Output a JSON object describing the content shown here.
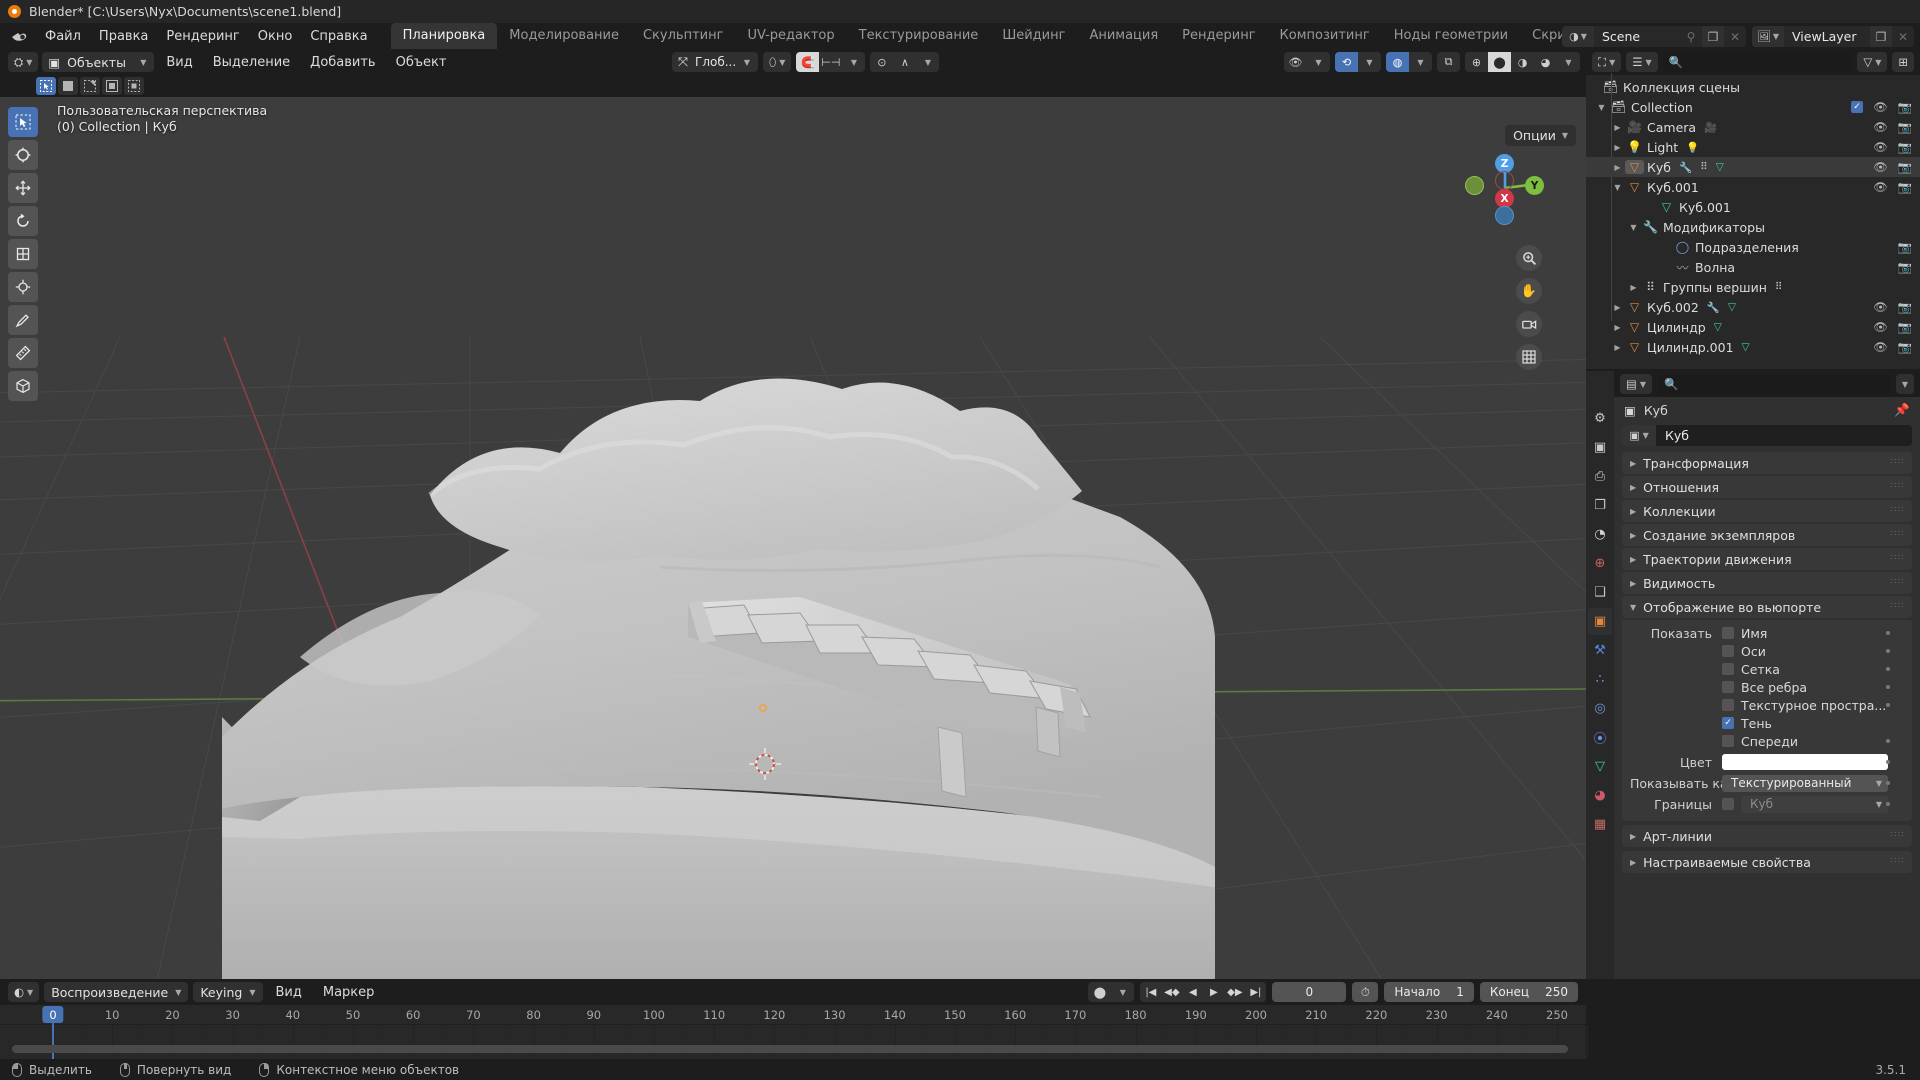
{
  "window": {
    "title": "Blender* [C:\\Users\\Nyx\\Documents\\scene1.blend]",
    "app_icon": "blender-logo-icon"
  },
  "menus": [
    "Файл",
    "Правка",
    "Рендеринг",
    "Окно",
    "Справка"
  ],
  "workspace_tabs": [
    {
      "label": "Планировка",
      "active": true
    },
    {
      "label": "Моделирование",
      "active": false
    },
    {
      "label": "Скульптинг",
      "active": false
    },
    {
      "label": "UV-редактор",
      "active": false
    },
    {
      "label": "Текстурирование",
      "active": false
    },
    {
      "label": "Шейдинг",
      "active": false
    },
    {
      "label": "Анимация",
      "active": false
    },
    {
      "label": "Рендеринг",
      "active": false
    },
    {
      "label": "Композитинг",
      "active": false
    },
    {
      "label": "Ноды геометрии",
      "active": false
    },
    {
      "label": "Скриптинг",
      "active": false
    }
  ],
  "workspace_add": "+",
  "topbar_right": {
    "scene_name": "Scene",
    "viewlayer_name": "ViewLayer"
  },
  "viewport": {
    "mode": "Объекты",
    "menus": [
      "Вид",
      "Выделение",
      "Добавить",
      "Объект"
    ],
    "transform_orientation": "Глоб...",
    "options_label": "Опции",
    "overlay_line1": "Пользовательская перспектива",
    "overlay_line2": "(0) Collection | Куб",
    "gizmo_axes": {
      "z": "Z",
      "x": "X",
      "y": "Y"
    },
    "tools": [
      "select-box-tool",
      "cursor-tool",
      "move-tool",
      "rotate-tool",
      "scale-tool",
      "transform-tool",
      "annotate-tool",
      "measure-tool",
      "add-cube-tool"
    ]
  },
  "outliner": {
    "search_placeholder": "",
    "root_label": "Коллекция сцены",
    "rows": [
      {
        "label": "Collection",
        "indent": 0,
        "tri": "▼",
        "icon": "collection-icon",
        "icon_color": "#d8d8d8",
        "checkbox": true,
        "eye": true,
        "camera": true,
        "selected": false,
        "badges": []
      },
      {
        "label": "Camera",
        "indent": 1,
        "tri": "▶",
        "icon": "camera-object-icon",
        "icon_color": "#e2a45e",
        "checkbox": false,
        "eye": true,
        "camera": true,
        "selected": false,
        "badges": [
          "camera-data-icon"
        ]
      },
      {
        "label": "Light",
        "indent": 1,
        "tri": "▶",
        "icon": "light-object-icon",
        "icon_color": "#e2a45e",
        "checkbox": false,
        "eye": true,
        "camera": true,
        "selected": false,
        "badges": [
          "light-data-icon"
        ]
      },
      {
        "label": "Куб",
        "indent": 1,
        "tri": "▶",
        "icon": "mesh-object-icon",
        "icon_color": "#e2883c",
        "checkbox": false,
        "eye": true,
        "camera": true,
        "selected": true,
        "badges": [
          "modifier-icon",
          "vertex-group-icon",
          "mesh-data-icon"
        ]
      },
      {
        "label": "Куб.001",
        "indent": 1,
        "tri": "▼",
        "icon": "mesh-object-icon",
        "icon_color": "#e2883c",
        "checkbox": false,
        "eye": true,
        "camera": true,
        "selected": false,
        "badges": []
      },
      {
        "label": "Куб.001",
        "indent": 3,
        "tri": "",
        "icon": "mesh-data-icon",
        "icon_color": "#3ecf8e",
        "checkbox": false,
        "eye": false,
        "camera": false,
        "selected": false,
        "badges": []
      },
      {
        "label": "Модификаторы",
        "indent": 2,
        "tri": "▼",
        "icon": "modifier-icon",
        "icon_color": "#7a9ce8",
        "checkbox": false,
        "eye": false,
        "camera": false,
        "selected": false,
        "badges": []
      },
      {
        "label": "Подразделения",
        "indent": 4,
        "tri": "",
        "icon": "subdivision-icon",
        "icon_color": "#7a9ce8",
        "checkbox": false,
        "eye": false,
        "camera": true,
        "selected": false,
        "badges": []
      },
      {
        "label": "Волна",
        "indent": 4,
        "tri": "",
        "icon": "wave-icon",
        "icon_color": "#9aa8bd",
        "checkbox": false,
        "eye": false,
        "camera": true,
        "selected": false,
        "badges": []
      },
      {
        "label": "Группы вершин",
        "indent": 2,
        "tri": "▶",
        "icon": "vertex-group-icon",
        "icon_color": "#c5c5c5",
        "checkbox": false,
        "eye": false,
        "camera": false,
        "selected": false,
        "badges": [
          "vertex-group-icon"
        ]
      },
      {
        "label": "Куб.002",
        "indent": 1,
        "tri": "▶",
        "icon": "mesh-object-icon",
        "icon_color": "#e2883c",
        "checkbox": false,
        "eye": true,
        "camera": true,
        "selected": false,
        "badges": [
          "modifier-icon",
          "mesh-data-icon"
        ]
      },
      {
        "label": "Цилиндр",
        "indent": 1,
        "tri": "▶",
        "icon": "mesh-object-icon",
        "icon_color": "#e2883c",
        "checkbox": false,
        "eye": true,
        "camera": true,
        "selected": false,
        "badges": [
          "mesh-data-icon"
        ]
      },
      {
        "label": "Цилиндр.001",
        "indent": 1,
        "tri": "▶",
        "icon": "mesh-object-icon",
        "icon_color": "#e2883c",
        "checkbox": false,
        "eye": true,
        "camera": true,
        "selected": false,
        "badges": [
          "mesh-data-icon"
        ]
      }
    ]
  },
  "properties": {
    "search_placeholder": "",
    "breadcrumb_object": "Куб",
    "name_field_value": "Куб",
    "tabs": [
      {
        "name": "tool-tab",
        "glyph": "⚙",
        "color": "#c9c9c9",
        "active": false
      },
      {
        "name": "render-tab",
        "glyph": "▣",
        "color": "#c9c9c9",
        "active": false
      },
      {
        "name": "output-tab",
        "glyph": "⎙",
        "color": "#c9c9c9",
        "active": false
      },
      {
        "name": "view-layer-tab",
        "glyph": "❐",
        "color": "#c9c9c9",
        "active": false
      },
      {
        "name": "scene-tab",
        "glyph": "◔",
        "color": "#d2d2d2",
        "active": false
      },
      {
        "name": "world-tab",
        "glyph": "⊕",
        "color": "#cc6262",
        "active": false
      },
      {
        "name": "collection-tab",
        "glyph": "❑",
        "color": "#c9c9c9",
        "active": false
      },
      {
        "name": "object-tab",
        "glyph": "▣",
        "color": "#e2883c",
        "active": true
      },
      {
        "name": "modifier-tab",
        "glyph": "⚒",
        "color": "#5a82d8",
        "active": false
      },
      {
        "name": "particles-tab",
        "glyph": "∴",
        "color": "#7a9ce8",
        "active": false
      },
      {
        "name": "physics-tab",
        "glyph": "◎",
        "color": "#6d93e0",
        "active": false
      },
      {
        "name": "constraints-tab",
        "glyph": "⦿",
        "color": "#6d93e0",
        "active": false
      },
      {
        "name": "data-tab",
        "glyph": "▽",
        "color": "#3ecf8e",
        "active": false
      },
      {
        "name": "material-tab",
        "glyph": "◕",
        "color": "#cc5a6a",
        "active": false
      },
      {
        "name": "texture-tab",
        "glyph": "▦",
        "color": "#c26a6a",
        "active": false
      }
    ],
    "panels": [
      {
        "label": "Трансформация",
        "open": false
      },
      {
        "label": "Отношения",
        "open": false
      },
      {
        "label": "Коллекции",
        "open": false
      },
      {
        "label": "Создание экземпляров",
        "open": false
      },
      {
        "label": "Траектории движения",
        "open": false
      },
      {
        "label": "Видимость",
        "open": false
      },
      {
        "label": "Отображение во вьюпорте",
        "open": true
      }
    ],
    "viewport_display": {
      "show_label": "Показать",
      "checkboxes": [
        {
          "label": "Имя",
          "checked": false
        },
        {
          "label": "Оси",
          "checked": false
        },
        {
          "label": "Сетка",
          "checked": false
        },
        {
          "label": "Все ребра",
          "checked": false
        },
        {
          "label": "Текстурное простра...",
          "checked": false
        },
        {
          "label": "Тень",
          "checked": true
        },
        {
          "label": "Спереди",
          "checked": false
        }
      ],
      "color_label": "Цвет",
      "color_value": "#ffffff",
      "display_as_label": "Показывать как",
      "display_as_value": "Текстурированный",
      "bounds_label": "Границы",
      "bounds_checked": false,
      "bounds_value": "Куб"
    },
    "trailing_panels": [
      {
        "label": "Арт-линии",
        "open": false
      },
      {
        "label": "Настраиваемые свойства",
        "open": false
      }
    ]
  },
  "timeline": {
    "editor_menus": [
      "Воспроизведение",
      "Keying",
      "Вид",
      "Маркер"
    ],
    "current_frame": "0",
    "start_label": "Начало",
    "start_value": "1",
    "end_label": "Конец",
    "end_value": "250",
    "playhead_frame": "0",
    "ticks": [
      "0",
      "10",
      "20",
      "30",
      "40",
      "50",
      "60",
      "70",
      "80",
      "90",
      "100",
      "110",
      "120",
      "130",
      "140",
      "150",
      "160",
      "170",
      "180",
      "190",
      "200",
      "210",
      "220",
      "230",
      "240",
      "250"
    ]
  },
  "statusbar": {
    "items": [
      {
        "mouse": "left",
        "label": "Выделить"
      },
      {
        "mouse": "middle",
        "label": "Повернуть вид"
      },
      {
        "mouse": "right",
        "label": "Контекстное меню объектов"
      }
    ],
    "version": "3.5.1"
  },
  "colors": {
    "accent": "#4772b3",
    "object_orange": "#e2883c",
    "mesh_green": "#3ecf8e",
    "brand": "#e87d0d"
  }
}
